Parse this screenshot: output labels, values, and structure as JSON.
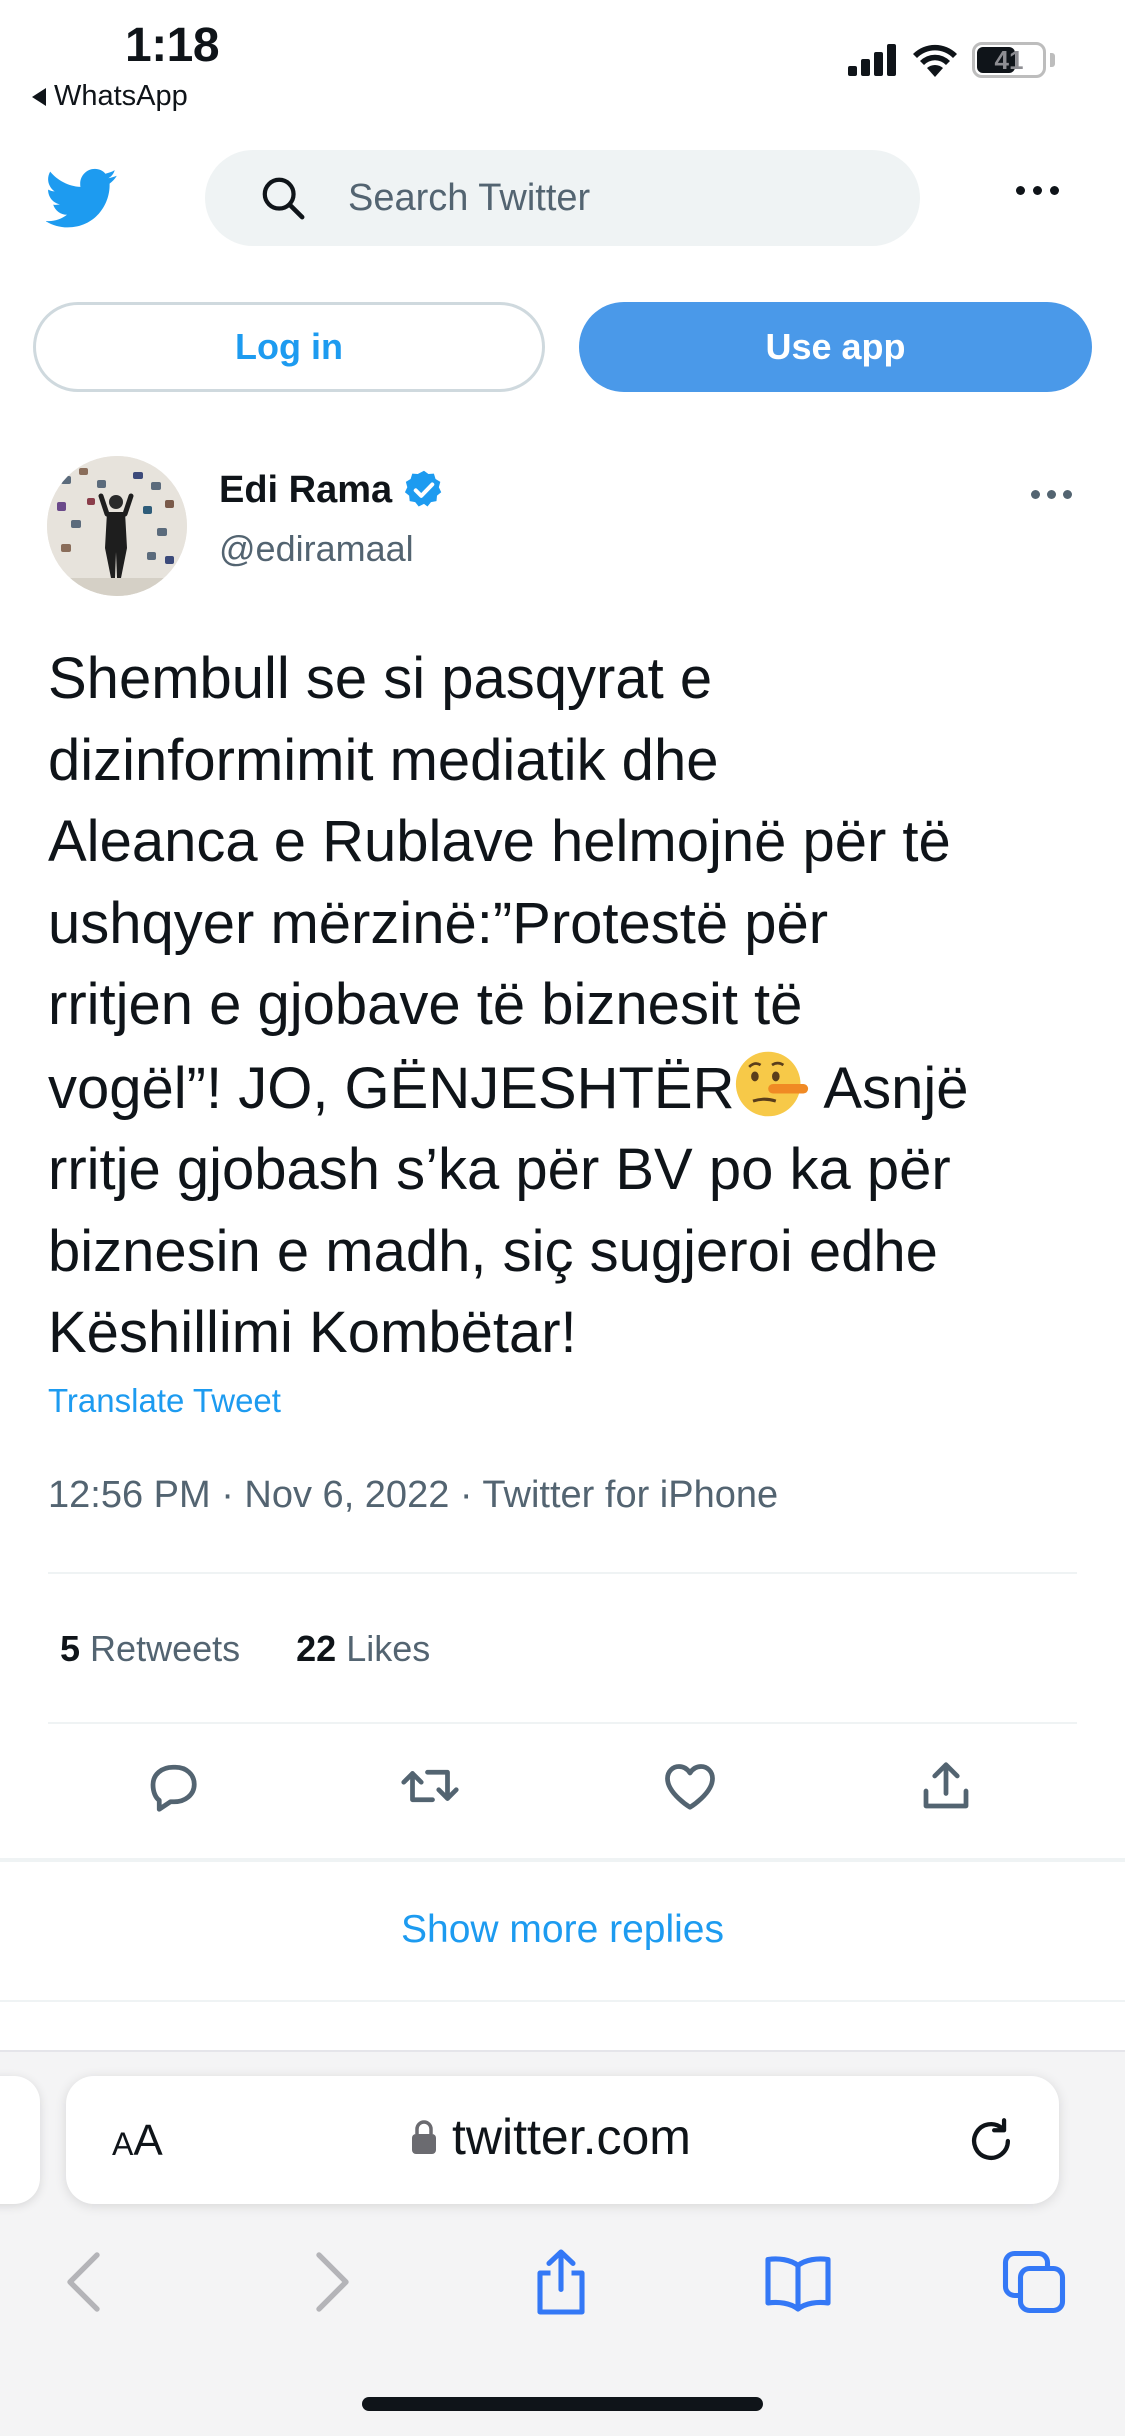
{
  "status": {
    "time": "1:18",
    "back_app": "WhatsApp",
    "battery": "41"
  },
  "header": {
    "search_placeholder": "Search Twitter"
  },
  "buttons": {
    "login": "Log in",
    "use_app": "Use app"
  },
  "tweet": {
    "author_name": "Edi Rama",
    "author_handle": "@ediramaal",
    "text_part1": "Shembull se si pasqyrat e\ndizinformimit mediatik dhe\nAleanca e Rublave helmojnë për të\nushqyer mërzinë:”Protestë për\nrritjen e gjobave të biznesit të\nvogël”! JO, GËNJESHTËR",
    "text_part2": " Asnjë\nrritje gjobash s’ka për BV po ka për\nbiznesin e madh, siç sugjeroi edhe\nKëshillimi Kombëtar!",
    "emoji": "lying-face-emoji",
    "translate": "Translate Tweet",
    "meta": "12:56 PM · Nov 6, 2022 · Twitter for iPhone",
    "retweets_count": "5",
    "retweets_label": "Retweets",
    "likes_count": "22",
    "likes_label": "Likes"
  },
  "replies": {
    "show_more": "Show more replies"
  },
  "browser": {
    "aa_small": "A",
    "aa_large": "A",
    "url": "twitter.com"
  },
  "colors": {
    "twitter_blue": "#1d9bf0",
    "button_blue": "#4a99e9",
    "text": "#0f1419",
    "muted": "#536471"
  }
}
